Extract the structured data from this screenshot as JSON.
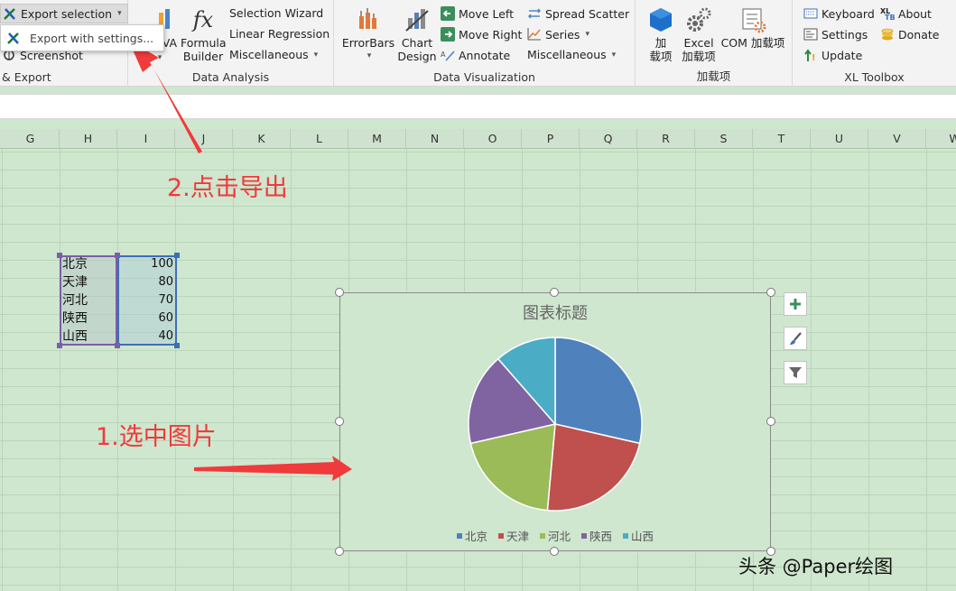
{
  "ribbon": {
    "export_group": {
      "export_selection": "Export selection",
      "screenshot": "Screenshot",
      "label": "& Export",
      "menu_item": "Export with settings..."
    },
    "analysis_group": {
      "anova": "VA",
      "formula_builder_1": "Formula",
      "formula_builder_2": "Builder",
      "selection_wizard": "Selection Wizard",
      "linear_regression": "Linear Regression",
      "miscellaneous": "Miscellaneous",
      "label": "Data Analysis"
    },
    "viz_group": {
      "errorbars": "ErrorBars",
      "chart_design_1": "Chart",
      "chart_design_2": "Design",
      "move_left": "Move Left",
      "move_right": "Move Right",
      "annotate": "Annotate",
      "spread_scatter": "Spread Scatter",
      "series": "Series",
      "miscellaneous": "Miscellaneous",
      "label": "Data Visualization"
    },
    "addins_group": {
      "addin_1": "加",
      "addin_2": "载项",
      "excel_1": "Excel",
      "excel_2": "加载项",
      "com": "COM",
      "com_addin": "加载项",
      "label": "加载项"
    },
    "toolbox_group": {
      "keyboard": "Keyboard",
      "settings": "Settings",
      "update": "Update",
      "about": "About",
      "donate": "Donate",
      "label": "XL Toolbox"
    }
  },
  "columns": [
    "G",
    "H",
    "I",
    "J",
    "K",
    "L",
    "M",
    "N",
    "O",
    "P",
    "Q",
    "R",
    "S",
    "T",
    "U",
    "V",
    "W"
  ],
  "table": {
    "names": [
      "北京",
      "天津",
      "河北",
      "陕西",
      "山西"
    ],
    "values": [
      "100",
      "80",
      "70",
      "60",
      "40"
    ]
  },
  "chart_data": {
    "type": "pie",
    "title": "图表标题",
    "categories": [
      "北京",
      "天津",
      "河北",
      "陕西",
      "山西"
    ],
    "values": [
      100,
      80,
      70,
      60,
      40
    ],
    "colors": [
      "#4f81bd",
      "#c0504d",
      "#9bbb59",
      "#8064a2",
      "#4bacc6"
    ],
    "legend": "bottom"
  },
  "annotations": {
    "step1": "1.选中图片",
    "step2": "2.点击导出"
  },
  "watermark": "头条 @Paper绘图",
  "colors": {
    "annotation_red": "#ef3b3b",
    "sheet_green": "#cfe6cf"
  }
}
